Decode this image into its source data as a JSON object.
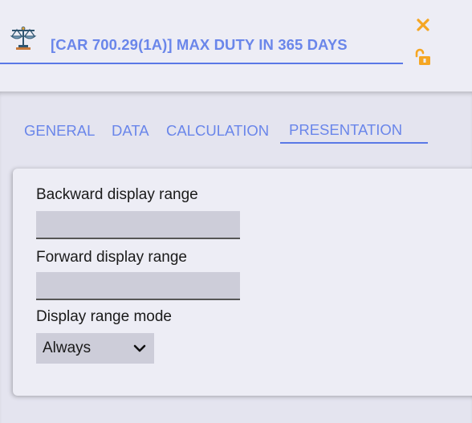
{
  "header": {
    "title": "[CAR 700.29(1A)] MAX DUTY IN 365 DAYS",
    "icons": {
      "title": "scale-icon",
      "close": "close-icon",
      "lock": "unlock-icon"
    }
  },
  "tabs": [
    {
      "label": "GENERAL",
      "active": false
    },
    {
      "label": "DATA",
      "active": false
    },
    {
      "label": "CALCULATION",
      "active": false
    },
    {
      "label": "PRESENTATION",
      "active": true
    }
  ],
  "form": {
    "backward_range": {
      "label": "Backward display range",
      "value": ""
    },
    "forward_range": {
      "label": "Forward display range",
      "value": ""
    },
    "range_mode": {
      "label": "Display range mode",
      "selected": "Always"
    }
  },
  "colors": {
    "accent": "#6a86ea",
    "orange": "#f5a623",
    "background": "#e8e8f2",
    "input_bg": "#cdcdd9"
  }
}
